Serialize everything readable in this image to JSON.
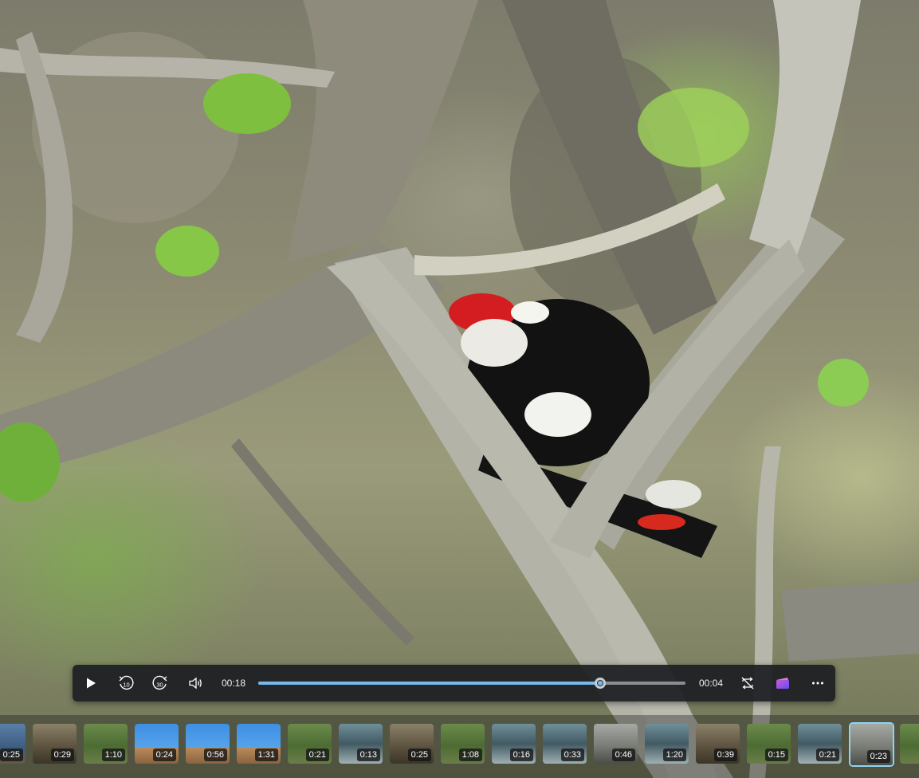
{
  "player": {
    "elapsed": "00:18",
    "remaining": "00:04",
    "progress": 0.8
  },
  "controls": {
    "rewind_seconds": "10",
    "forward_seconds": "30"
  },
  "colors": {
    "accent": "#76b9ed",
    "bar_background": "#1c1e22",
    "selected_border": "#8fd2f4"
  },
  "icons": {
    "play": "play-icon",
    "rewind": "rewind-10-icon",
    "forward": "forward-30-icon",
    "volume": "volume-icon",
    "repeat": "repeat-off-icon",
    "clipchamp": "clipchamp-icon",
    "more": "more-options-icon"
  },
  "filmstrip": {
    "selected_index": 17,
    "items": [
      {
        "duration": "0:25",
        "scene": "blue"
      },
      {
        "duration": "0:29",
        "scene": "brown"
      },
      {
        "duration": "1:10",
        "scene": "green"
      },
      {
        "duration": "0:24",
        "scene": "sky"
      },
      {
        "duration": "0:56",
        "scene": "sky"
      },
      {
        "duration": "1:31",
        "scene": "sky"
      },
      {
        "duration": "0:21",
        "scene": "green"
      },
      {
        "duration": "0:13",
        "scene": "water"
      },
      {
        "duration": "0:25",
        "scene": "brown"
      },
      {
        "duration": "1:08",
        "scene": "green"
      },
      {
        "duration": "0:16",
        "scene": "water"
      },
      {
        "duration": "0:33",
        "scene": "water"
      },
      {
        "duration": "0:46",
        "scene": "grey"
      },
      {
        "duration": "1:20",
        "scene": "water"
      },
      {
        "duration": "0:39",
        "scene": "brown"
      },
      {
        "duration": "0:15",
        "scene": "green"
      },
      {
        "duration": "0:21",
        "scene": "water"
      },
      {
        "duration": "0:23",
        "scene": "grey"
      },
      {
        "duration": "",
        "scene": "green"
      }
    ]
  }
}
